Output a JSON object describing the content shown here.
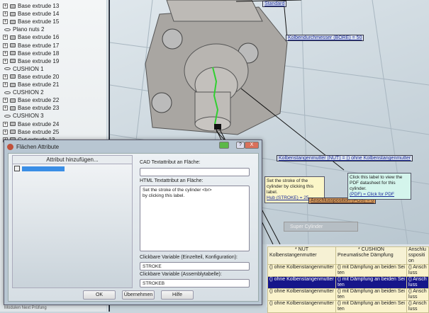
{
  "tree": {
    "items": [
      {
        "label": "Base extrude 13",
        "type": "extrude"
      },
      {
        "label": "Base extrude 14",
        "type": "extrude"
      },
      {
        "label": "Base extrude 15",
        "type": "extrude"
      },
      {
        "label": "Plano nuts 2",
        "type": "plane"
      },
      {
        "label": "Base extrude 16",
        "type": "extrude"
      },
      {
        "label": "Base extrude 17",
        "type": "extrude"
      },
      {
        "label": "Base extrude 18",
        "type": "extrude"
      },
      {
        "label": "Base extrude 19",
        "type": "extrude"
      },
      {
        "label": "CUSHION 1",
        "type": "plane"
      },
      {
        "label": "Base extrude 20",
        "type": "extrude"
      },
      {
        "label": "Base extrude 21",
        "type": "extrude"
      },
      {
        "label": "CUSHION 2",
        "type": "plane"
      },
      {
        "label": "Base extrude 22",
        "type": "extrude"
      },
      {
        "label": "Base extrude 23",
        "type": "extrude"
      },
      {
        "label": "CUSHION 3",
        "type": "plane"
      },
      {
        "label": "Base extrude 24",
        "type": "extrude"
      },
      {
        "label": "Base extrude 25",
        "type": "extrude"
      },
      {
        "label": "Cut extrude 13",
        "type": "extrude"
      }
    ]
  },
  "viewport": {
    "labels": {
      "standard": "Standard",
      "bore": "Kolbendurchmesser (BORE) = 50",
      "nut": "Kolbenstangenmutter (NUT) = () ohne Kolbenstangenmutter",
      "stroke_note": "Set the stroke of the cylinder by clicking this label.",
      "stroke": "Hub (STROKE) = 25",
      "pos": "Anschlussposition (POS) = 0",
      "pdf_note": "Click this label to view the PDF datasheet for this cylinder.",
      "pdf": "(PDF) = Click for PDF",
      "super": "Super Cylinder"
    }
  },
  "dialog": {
    "title": "Flächen Attribute",
    "add_attribute": "Attribut hinzufügen...",
    "cad_label": "CAD Textattribut an Fläche:",
    "cad_value": "",
    "html_label": "HTML Textattribut an Fläche:",
    "html_value": "Set the stroke of the cylinder <br>\nby clicking this label.",
    "var1_label": "Clickbare Variable (Einzelteil, Konfiguration):",
    "var1_value": "STROKE",
    "var2_label": "Clickbare Variable (Assemblytabelle):",
    "var2_value": "STROKEB",
    "ok": "OK",
    "apply": "Übernehmen",
    "help": "Hilfe",
    "help_btn": "?",
    "close_btn": "X"
  },
  "table": {
    "headers": [
      {
        "key": "* NUT",
        "sub": "Kolbenstangenmutter"
      },
      {
        "key": "* CUSHION",
        "sub": "Pneumatische Dämpfung"
      },
      {
        "key": "",
        "sub": "Anschlussposition"
      }
    ],
    "rows": [
      [
        "() ohne Kolbenstangenmutter",
        "() mit Dämpfung an beiden Seiten",
        "() Anschluss"
      ],
      [
        "() ohne Kolbenstangenmutter",
        "() mit Dämpfung an beiden Seiten",
        "() Anschluss"
      ],
      [
        "() ohne Kolbenstangenmutter",
        "() mit Dämpfung an beiden Seiten",
        "() Anschluss"
      ],
      [
        "() ohne Kolbenstangenmutter",
        "() mit Dämpfung an beiden Seiten",
        "() Anschluss"
      ]
    ],
    "selected_row": 1
  },
  "status": "Modulen  Next  Prüfung"
}
